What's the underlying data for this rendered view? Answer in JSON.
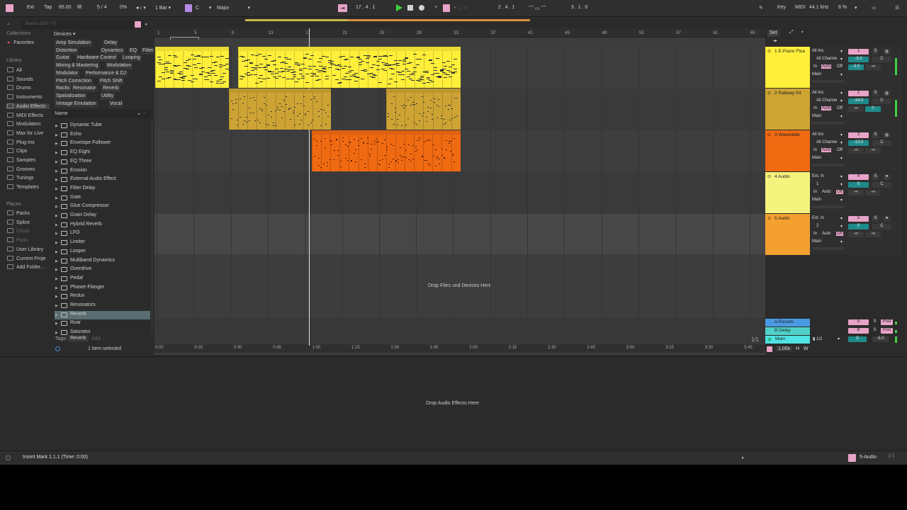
{
  "topbar": {
    "ext": "Ext",
    "tap": "Tap",
    "tempo": "85.00",
    "signature": "5 / 4",
    "groove_pct": "0%",
    "quantize": "1 Bar",
    "key": "C",
    "scale": "Major",
    "position": "17 . 4 . 1",
    "loop_start": "2 . 4 . 1",
    "loop_length": "3 . 1 . 0",
    "key_map": "Key",
    "midi_map": "MIDI",
    "sample_rate": "44.1 kHz",
    "cpu": "8 %"
  },
  "browser": {
    "search_placeholder": "Search (Ctrl + F)",
    "collections_label": "Collections",
    "favorites": "Favorites",
    "library_label": "Library",
    "library": [
      "All",
      "Sounds",
      "Drums",
      "Instruments",
      "Audio Effects",
      "MIDI Effects",
      "Modulators",
      "Max for Live",
      "Plug-Ins",
      "Clips",
      "Samples",
      "Grooves",
      "Tunings",
      "Templates"
    ],
    "places_label": "Places",
    "places": [
      "Packs",
      "Splice",
      "Cloud",
      "Push",
      "User Library",
      "Current Proje",
      "Add Folder..."
    ],
    "devices_label": "Devices",
    "chips": [
      [
        "Amp Simulation",
        "Delay"
      ],
      [
        "Distortion",
        "Dynamics",
        "EQ",
        "Filter"
      ],
      [
        "Guitar",
        "Hardware Control",
        "Looping"
      ],
      [
        "Mixing & Mastering",
        "Modulation"
      ],
      [
        "Modulator",
        "Performance & DJ"
      ],
      [
        "Pitch Correction",
        "Pitch Shift"
      ],
      [
        "Racks",
        "Resonator",
        "Reverb"
      ],
      [
        "Spatialization",
        "Utility"
      ],
      [
        "Vintage Emulation",
        "Vocal"
      ]
    ],
    "name_col": "Name",
    "files": [
      "Dynamic Tube",
      "Echo",
      "Envelope Follower",
      "EQ Eight",
      "EQ Three",
      "Erosion",
      "External Audio Effect",
      "Filter Delay",
      "Gate",
      "Glue Compressor",
      "Grain Delay",
      "Hybrid Reverb",
      "LFO",
      "Limiter",
      "Looper",
      "Multiband Dynamics",
      "Overdrive",
      "Pedal",
      "Phaser-Flanger",
      "Redux",
      "Resonators",
      "Reverb",
      "Roar",
      "Saturator"
    ],
    "tags_label": "Tags:",
    "tag": "Reverb",
    "tag_add": "Add...",
    "selected": "1 item selected"
  },
  "ruler": {
    "bars": [
      "1",
      "5",
      "9",
      "13",
      "17",
      "21",
      "25",
      "29",
      "33",
      "37",
      "41",
      "45",
      "49",
      "53",
      "57",
      "61",
      "65"
    ],
    "times": [
      "0:00",
      "0:15",
      "0:30",
      "0:45",
      "1:00",
      "1:15",
      "1:30",
      "1:45",
      "2:00",
      "2:15",
      "2:30",
      "2:45",
      "3:00",
      "3:15",
      "3:30",
      "3:45"
    ]
  },
  "tracks": [
    {
      "name": "1 E-Piano Floa",
      "input": "All Ins",
      "channel": "All Channe",
      "mon": "In",
      "auto": "Auto",
      "off": "Off",
      "out": "Main",
      "num": "1",
      "vol": "-3.0",
      "pan": "C",
      "send": "-3.5",
      "send2": "-∞",
      "color": "#ffef3a"
    },
    {
      "name": "2 Railway Kit",
      "input": "All Ins",
      "channel": "All Channe",
      "mon": "In",
      "auto": "Auto",
      "off": "Off",
      "out": "Main",
      "num": "2",
      "vol": "-14.0",
      "pan": "C",
      "send": "-∞",
      "send2": "0",
      "color": "#cda334"
    },
    {
      "name": "3 Wavetable",
      "input": "All Ins",
      "channel": "All Channe",
      "mon": "In",
      "auto": "Auto",
      "off": "Off",
      "out": "Main",
      "num": "3",
      "vol": "-13.0",
      "pan": "C",
      "send": "-∞",
      "send2": "-∞",
      "color": "#f06a12"
    },
    {
      "name": "4 Audio",
      "input": "Ext. In",
      "channel": "1",
      "mon": "In",
      "auto": "Auto",
      "off": "Off",
      "out": "Main",
      "num": "4",
      "vol": "0",
      "pan": "C",
      "send": "-∞",
      "send2": "-∞",
      "color": "#f4f37e"
    },
    {
      "name": "5 Audio",
      "input": "Ext. In",
      "channel": "2",
      "mon": "In",
      "auto": "Auto",
      "off": "Off",
      "out": "Main",
      "num": "5",
      "vol": "0",
      "pan": "C",
      "send": "-∞",
      "send2": "-∞",
      "color": "#f4a030"
    }
  ],
  "returns": [
    {
      "name": "A Reverb",
      "letter": "A",
      "post": "Post"
    },
    {
      "name": "B Delay",
      "letter": "B",
      "post": "Post"
    }
  ],
  "master": {
    "name": "Main",
    "cue": "1/2",
    "vol": "0",
    "pan": "-6.0",
    "zoom": "1.00x",
    "h": "H",
    "w": "W",
    "fraction": "1/1"
  },
  "drop_files": "Drop Files and Devices Here",
  "set_label": "Set",
  "drop_effects": "Drop Audio Effects Here",
  "status": {
    "text": "Insert Mark 1.1.1 (Time: 0:00)",
    "track": "5-Audio"
  }
}
